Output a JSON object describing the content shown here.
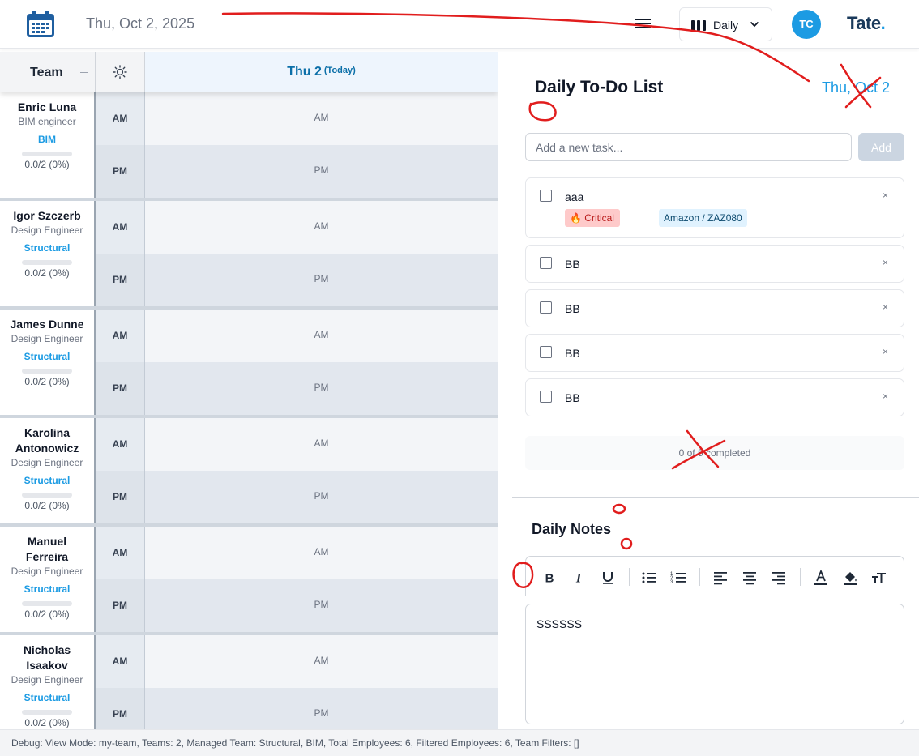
{
  "header": {
    "date": "Thu, Oct 2, 2025",
    "view_label": "Daily",
    "avatar_initials": "TC",
    "logo_text": "Tate",
    "logo_dot": "."
  },
  "schedule": {
    "team_header": "Team",
    "day_label": "Thu 2",
    "today_label": "(Today)",
    "am_label": "AM",
    "pm_label": "PM",
    "employees": [
      {
        "name": "Enric Luna",
        "role": "BIM engineer",
        "team": "BIM",
        "progress": "0.0/2 (0%)"
      },
      {
        "name": "Igor Szczerb",
        "role": "Design Engineer",
        "team": "Structural",
        "progress": "0.0/2 (0%)"
      },
      {
        "name": "James Dunne",
        "role": "Design Engineer",
        "team": "Structural",
        "progress": "0.0/2 (0%)"
      },
      {
        "name": "Karolina Antonowicz",
        "role": "Design Engineer",
        "team": "Structural",
        "progress": "0.0/2 (0%)"
      },
      {
        "name": "Manuel Ferreira",
        "role": "Design Engineer",
        "team": "Structural",
        "progress": "0.0/2 (0%)"
      },
      {
        "name": "Nicholas Isaakov",
        "role": "Design Engineer",
        "team": "Structural",
        "progress": "0.0/2 (0%)"
      }
    ]
  },
  "todo": {
    "title": "Daily To-Do List",
    "date": "Thu, Oct 2",
    "input_placeholder": "Add a new task...",
    "add_label": "Add",
    "close_glyph": "×",
    "tasks": [
      {
        "text": "aaa",
        "priority": "Critical",
        "project": "Amazon / ZAZ080"
      },
      {
        "text": "BB"
      },
      {
        "text": "BB"
      },
      {
        "text": "BB"
      },
      {
        "text": "BB"
      }
    ],
    "summary": "0 of 5 completed"
  },
  "notes": {
    "title": "Daily Notes",
    "content": "SSSSSS",
    "toolbar": [
      "bold-icon",
      "italic-icon",
      "underline-icon",
      "bullet-list-icon",
      "numbered-list-icon",
      "align-left-icon",
      "align-center-icon",
      "align-right-icon",
      "text-color-icon",
      "highlight-icon",
      "text-size-icon"
    ]
  },
  "debug": "Debug: View Mode: my-team, Teams: 2, Managed Team: Structural, BIM, Total Employees: 6, Filtered Employees: 6, Team Filters: []",
  "colors": {
    "accent": "#1c9be3",
    "annotation": "#e11d1d",
    "critical_bg": "#fecaca"
  }
}
